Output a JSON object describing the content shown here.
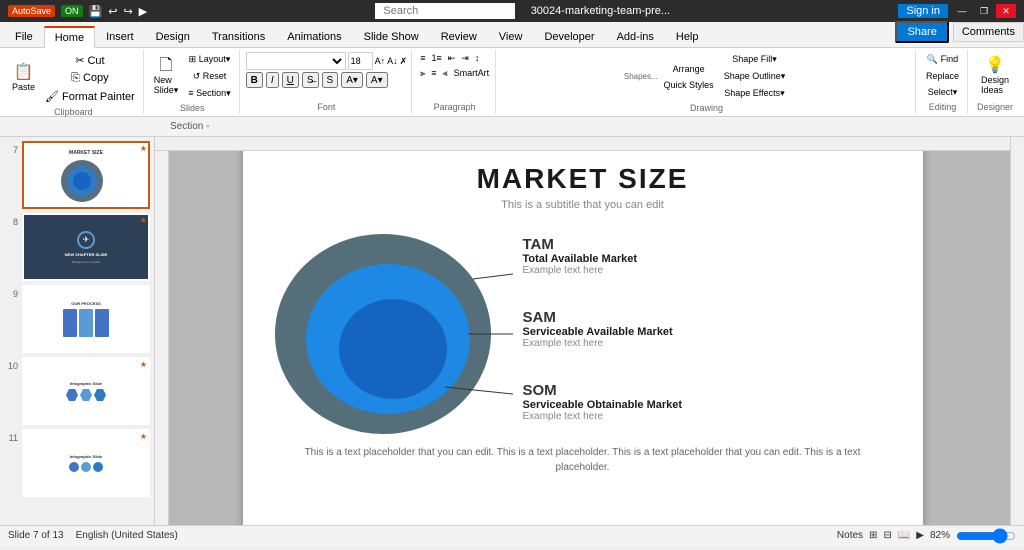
{
  "titlebar": {
    "autosave_label": "AutoSave",
    "autosave_state": "ON",
    "filename": "30024-marketing-team-pre...",
    "search_placeholder": "Search",
    "signin_label": "Sign in",
    "minimize": "—",
    "restore": "❐",
    "close": "✕"
  },
  "ribbon": {
    "tabs": [
      "File",
      "Home",
      "Insert",
      "Design",
      "Transitions",
      "Animations",
      "Slide Show",
      "Review",
      "View",
      "Developer",
      "Add-ins",
      "Help"
    ],
    "active_tab": "Home",
    "share_label": "Share",
    "comments_label": "Comments",
    "groups": {
      "clipboard": "Clipboard",
      "slides": "Slides",
      "font": "Font",
      "paragraph": "Paragraph",
      "drawing": "Drawing",
      "editing": "Editing",
      "designer": "Designer"
    }
  },
  "slides": [
    {
      "number": "7",
      "active": true,
      "starred": true,
      "type": "market-size"
    },
    {
      "number": "8",
      "active": false,
      "starred": true,
      "type": "chapter"
    },
    {
      "number": "9",
      "active": false,
      "starred": false,
      "type": "process"
    },
    {
      "number": "10",
      "active": false,
      "starred": true,
      "type": "infographic"
    },
    {
      "number": "11",
      "active": false,
      "starred": true,
      "type": "infographic2"
    }
  ],
  "slide": {
    "title": "MARKET SIZE",
    "subtitle": "This is a subtitle that you can edit",
    "section_label": "Section -",
    "markets": [
      {
        "tag": "TAM",
        "name": "Total Available Market",
        "description": "Example text here"
      },
      {
        "tag": "SAM",
        "name": "Serviceable Available Market",
        "description": "Example text here"
      },
      {
        "tag": "SOM",
        "name": "Serviceable Obtainable Market",
        "description": "Example text here"
      }
    ],
    "footer": "This is a text placeholder that you can edit. This is a text placeholder. This is a text placeholder that you can edit. This is a text placeholder."
  },
  "statusbar": {
    "slide_info": "Slide 7 of 13",
    "language": "English (United States)",
    "notes_label": "Notes",
    "zoom": "82%"
  }
}
